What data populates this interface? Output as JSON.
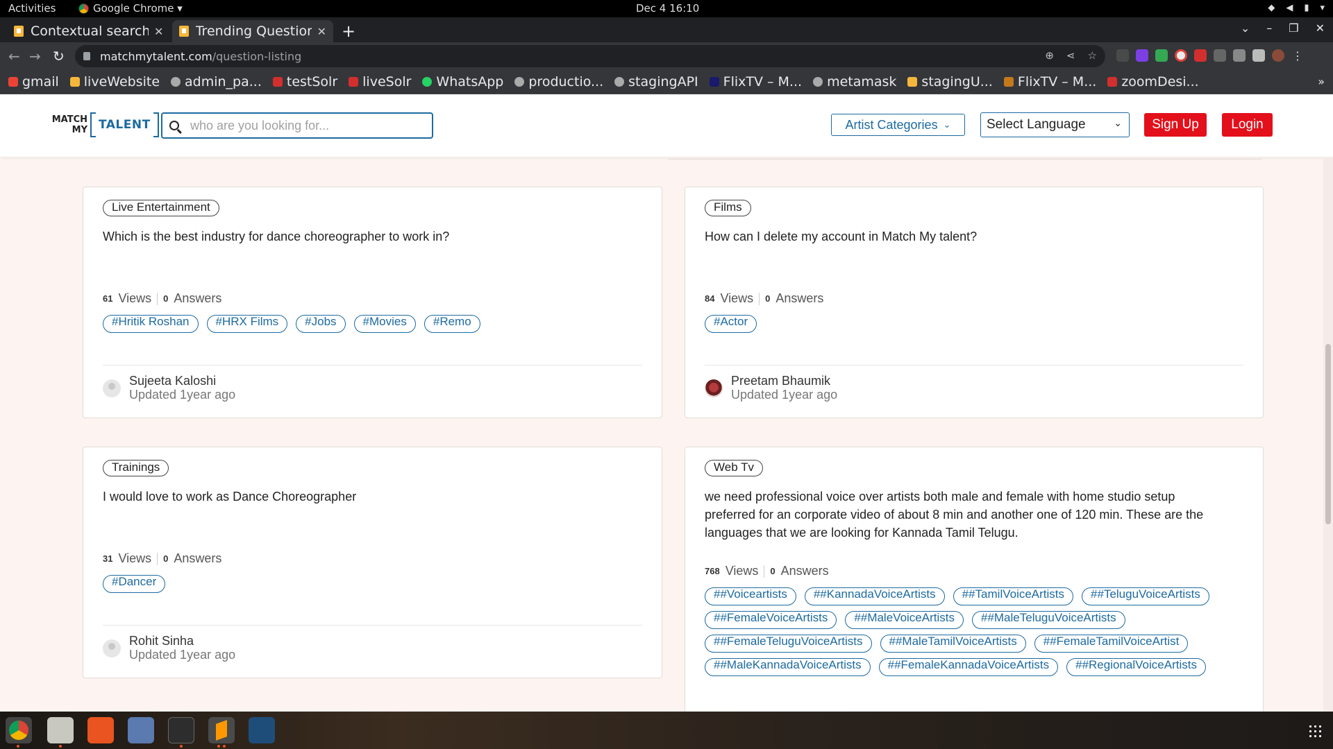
{
  "system": {
    "activities": "Activities",
    "app_name": "Google Chrome ▾",
    "clock": "Dec 4  16:10"
  },
  "browser": {
    "tabs": [
      {
        "title": "Contextual search",
        "active": false
      },
      {
        "title": "Trending Question",
        "active": true
      }
    ],
    "url_domain": "matchmytalent.com",
    "url_path": "/question-listing",
    "bookmarks": [
      "gmail",
      "liveWebsite",
      "admin_pa...",
      "testSolr",
      "liveSolr",
      "WhatsApp",
      "productio...",
      "stagingAPI",
      "FlixTV – M...",
      "metamask",
      "stagingU...",
      "FlixTV – M...",
      "zoomDesi..."
    ]
  },
  "header": {
    "logo_small": "MATCH MY",
    "logo_big": "TALENT",
    "search_placeholder": "who are you looking for...",
    "categories_label": "Artist Categories",
    "language_label": "Select Language",
    "signup_label": "Sign Up",
    "login_label": "Login"
  },
  "questions": [
    {
      "category": "Live Entertainment",
      "question": "Which is the best industry for dance choreographer to work in?",
      "views": "61",
      "views_label": "Views",
      "answers": "0",
      "answers_label": "Answers",
      "tags": [
        "#Hritik Roshan",
        "#HRX Films",
        "#Jobs",
        "#Movies",
        "#Remo"
      ],
      "author": "Sujeeta Kaloshi",
      "updated": "Updated 1year ago"
    },
    {
      "category": "Films",
      "question": "How can I delete my account in Match My talent?",
      "views": "84",
      "views_label": "Views",
      "answers": "0",
      "answers_label": "Answers",
      "tags": [
        "#Actor"
      ],
      "author": "Preetam Bhaumik",
      "updated": "Updated 1year ago"
    },
    {
      "category": "Trainings",
      "question": "I would love to work as Dance Choreographer",
      "views": "31",
      "views_label": "Views",
      "answers": "0",
      "answers_label": "Answers",
      "tags": [
        "#Dancer"
      ],
      "author": "Rohit Sinha",
      "updated": "Updated 1year ago"
    },
    {
      "category": "Web Tv",
      "question_lines": [
        "we need professional voice over artists both male and female with home studio setup",
        "preferred for an corporate video of about 8 min and another one of 120 min. These are the",
        "languages that we are looking for Kannada Tamil Telugu."
      ],
      "views": "768",
      "views_label": "Views",
      "answers": "0",
      "answers_label": "Answers",
      "tags": [
        "##Voiceartists",
        "##KannadaVoiceArtists",
        "##TamilVoiceArtists",
        "##TeluguVoiceArtists",
        "##FemaleVoiceArtists",
        "##MaleVoiceArtists",
        "##MaleTeluguVoiceArtists",
        "##FemaleTeluguVoiceArtists",
        "##MaleTamilVoiceArtists",
        "##FemaleTamilVoiceArtist",
        "##MaleKannadaVoiceArtists",
        "##FemaleKannadaVoiceArtists",
        "##RegionalVoiceArtists"
      ]
    }
  ],
  "colors": {
    "brand_blue": "#1c6aa0",
    "cta_red": "#e3101b",
    "page_bg": "#fdf4f1"
  }
}
